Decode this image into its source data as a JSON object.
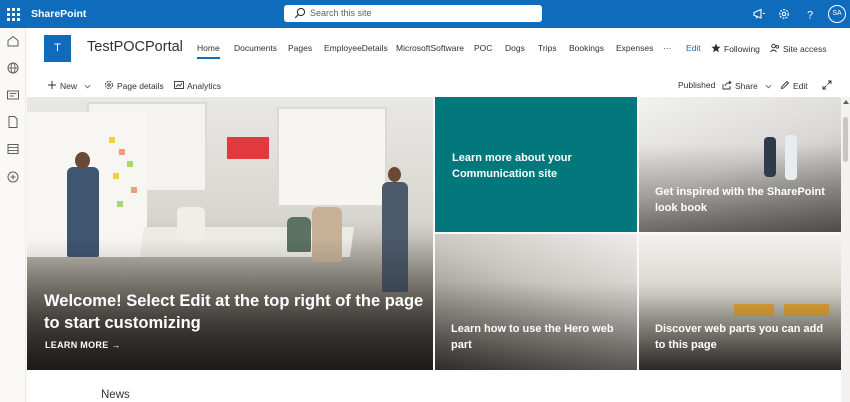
{
  "suite": {
    "app_name": "SharePoint",
    "search_placeholder": "Search this site",
    "avatar_initials": "SA",
    "accent": "#0f6cbd"
  },
  "left_rail": {
    "icons": [
      "home-icon",
      "globe-icon",
      "news-icon",
      "document-icon",
      "list-icon",
      "add-circle-icon"
    ]
  },
  "site": {
    "logo_letter": "T",
    "title": "TestPOCPortal",
    "nav": [
      "Home",
      "Documents",
      "Pages",
      "EmployeeDetails",
      "MicrosoftSoftware",
      "POC",
      "Dogs",
      "Trips",
      "Bookings",
      "Expenses",
      "···"
    ],
    "active_nav": "Home",
    "edit_label": "Edit",
    "following_label": "Following",
    "site_access_label": "Site access"
  },
  "command_bar": {
    "new_label": "New",
    "page_details_label": "Page details",
    "analytics_label": "Analytics",
    "status_label": "Published",
    "share_label": "Share",
    "edit_label": "Edit"
  },
  "hero": {
    "main_caption": "Welcome! Select Edit at the top right of the page to start customizing",
    "learn_more": "LEARN MORE",
    "tiles": [
      "Learn more about your Communication site",
      "Get inspired with the SharePoint look book",
      "Learn how to use the Hero web part",
      "Discover web parts you can add to this page"
    ],
    "teal_color": "#03787c",
    "lamp_color": "#e03a3e"
  },
  "news": {
    "heading": "News"
  }
}
